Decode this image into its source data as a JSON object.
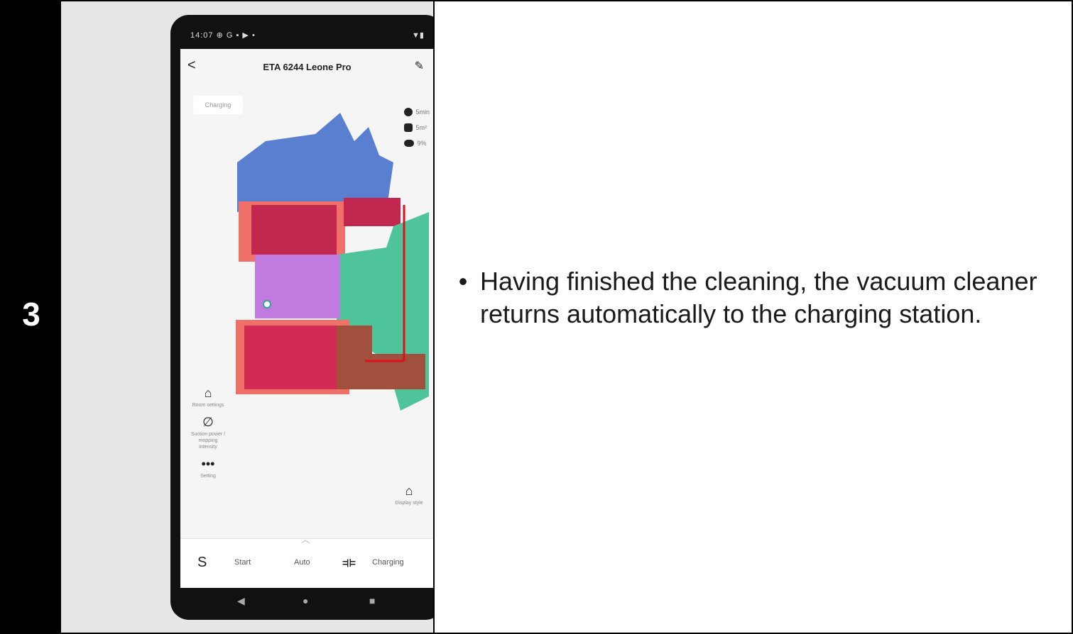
{
  "step": {
    "number": "3"
  },
  "instruction": {
    "bullet": "•",
    "text": "Having finished the cleaning, the vacuum cleaner returns automatically to the charging station."
  },
  "phone": {
    "status_bar": {
      "time": "14:07",
      "icons_left": "⊕ G ▪ ▶ •",
      "icons_right": "▼▮"
    },
    "app": {
      "back_glyph": "<",
      "title": "ETA 6244 Leone Pro",
      "edit_glyph": "✎",
      "status_chip": "Charging",
      "stats": {
        "time": "5min",
        "area": "5m²",
        "battery": "9%"
      }
    },
    "side_tools": {
      "room_settings": "Room settings",
      "suction_power": "Suction power / mopping intensity",
      "setting": "Setting",
      "display_style": "Display style",
      "more_glyph": "•••"
    },
    "bottom_bar": {
      "start_label": "Start",
      "mode_label": "Auto",
      "charge_label": "Charging",
      "chevron_glyph": "︿"
    },
    "nav": {
      "back": "◀",
      "home": "●",
      "recents": "■"
    }
  },
  "colors": {
    "blue_room": "#5a7fd0",
    "red_room": "#c2284f",
    "salmon_room": "#f0706a",
    "green_room": "#4fc49a",
    "purple_room": "#c07ae0",
    "brown_room": "#a0503c",
    "path_red": "#e0101a"
  }
}
